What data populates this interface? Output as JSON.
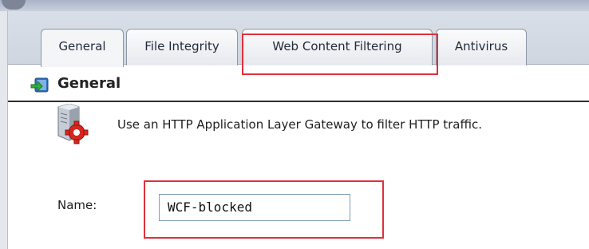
{
  "tabs": [
    {
      "label": "General",
      "active": true
    },
    {
      "label": "File Integrity",
      "active": false
    },
    {
      "label": "Web Content Filtering",
      "active": false
    },
    {
      "label": "Antivirus",
      "active": false
    }
  ],
  "section": {
    "title": "General",
    "icon": "arrow-into-folder-icon"
  },
  "gateway": {
    "icon": "server-gear-icon",
    "text": "Use an HTTP Application Layer Gateway to filter HTTP traffic."
  },
  "name_field": {
    "label": "Name:",
    "value": "WCF-blocked"
  },
  "colors": {
    "highlight": "#e0303c",
    "tab_bar": "#d9dfe8"
  }
}
